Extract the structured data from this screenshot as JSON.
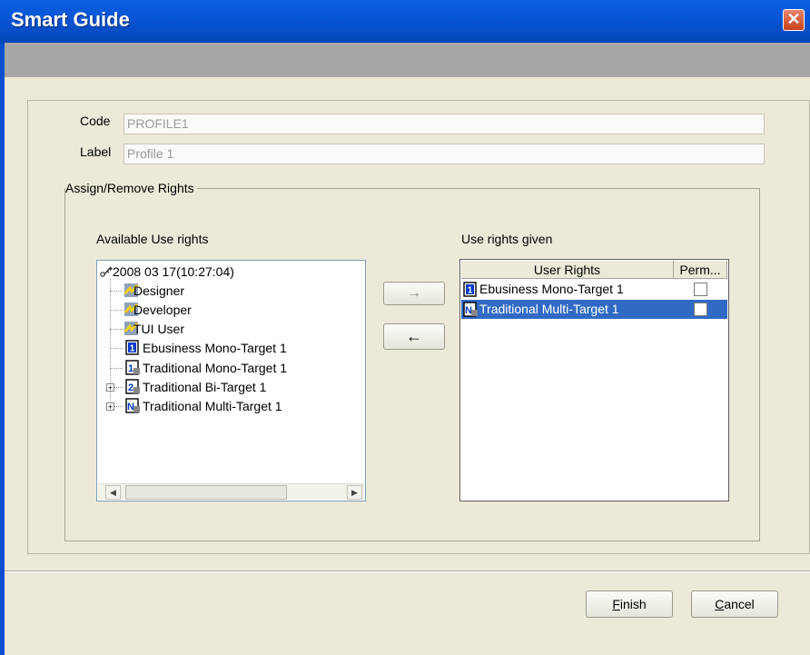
{
  "window": {
    "title": "Smart Guide",
    "close_glyph": "✕"
  },
  "form": {
    "code_label": "Code",
    "code_value": "PROFILE1",
    "label_label": "Label",
    "label_value": "Profile 1"
  },
  "rights": {
    "group_title": "Assign/Remove Rights",
    "available_title": "Available Use rights",
    "given_title": "Use rights given",
    "tree": [
      {
        "label": "2008 03 17(10:27:04)",
        "icon": "root-key-icon"
      },
      {
        "label": "Designer",
        "icon": "user-role-icon"
      },
      {
        "label": "Developer",
        "icon": "user-role-icon"
      },
      {
        "label": "TUI User",
        "icon": "user-role-icon"
      },
      {
        "label": "Ebusiness Mono-Target 1",
        "icon": "mono-target-1-icon"
      },
      {
        "label": "Traditional Mono-Target 1",
        "icon": "mono-target-1-icon"
      },
      {
        "label": "Traditional Bi-Target 1",
        "icon": "bi-target-2-icon",
        "expander": "+"
      },
      {
        "label": "Traditional Multi-Target 1",
        "icon": "multi-target-n-icon",
        "expander": "+"
      }
    ],
    "add_arrow": "→",
    "remove_arrow": "←",
    "table": {
      "headers": [
        "User Rights",
        "Perm..."
      ],
      "rows": [
        {
          "right": "Ebusiness Mono-Target 1",
          "perm": false,
          "selected": false,
          "icon": "mono-target-1-icon"
        },
        {
          "right": "Traditional Multi-Target 1",
          "perm": false,
          "selected": true,
          "icon": "multi-target-n-icon"
        }
      ]
    },
    "selection_color": "#316ac5"
  },
  "buttons": {
    "finish": "Finish",
    "cancel": "Cancel"
  }
}
